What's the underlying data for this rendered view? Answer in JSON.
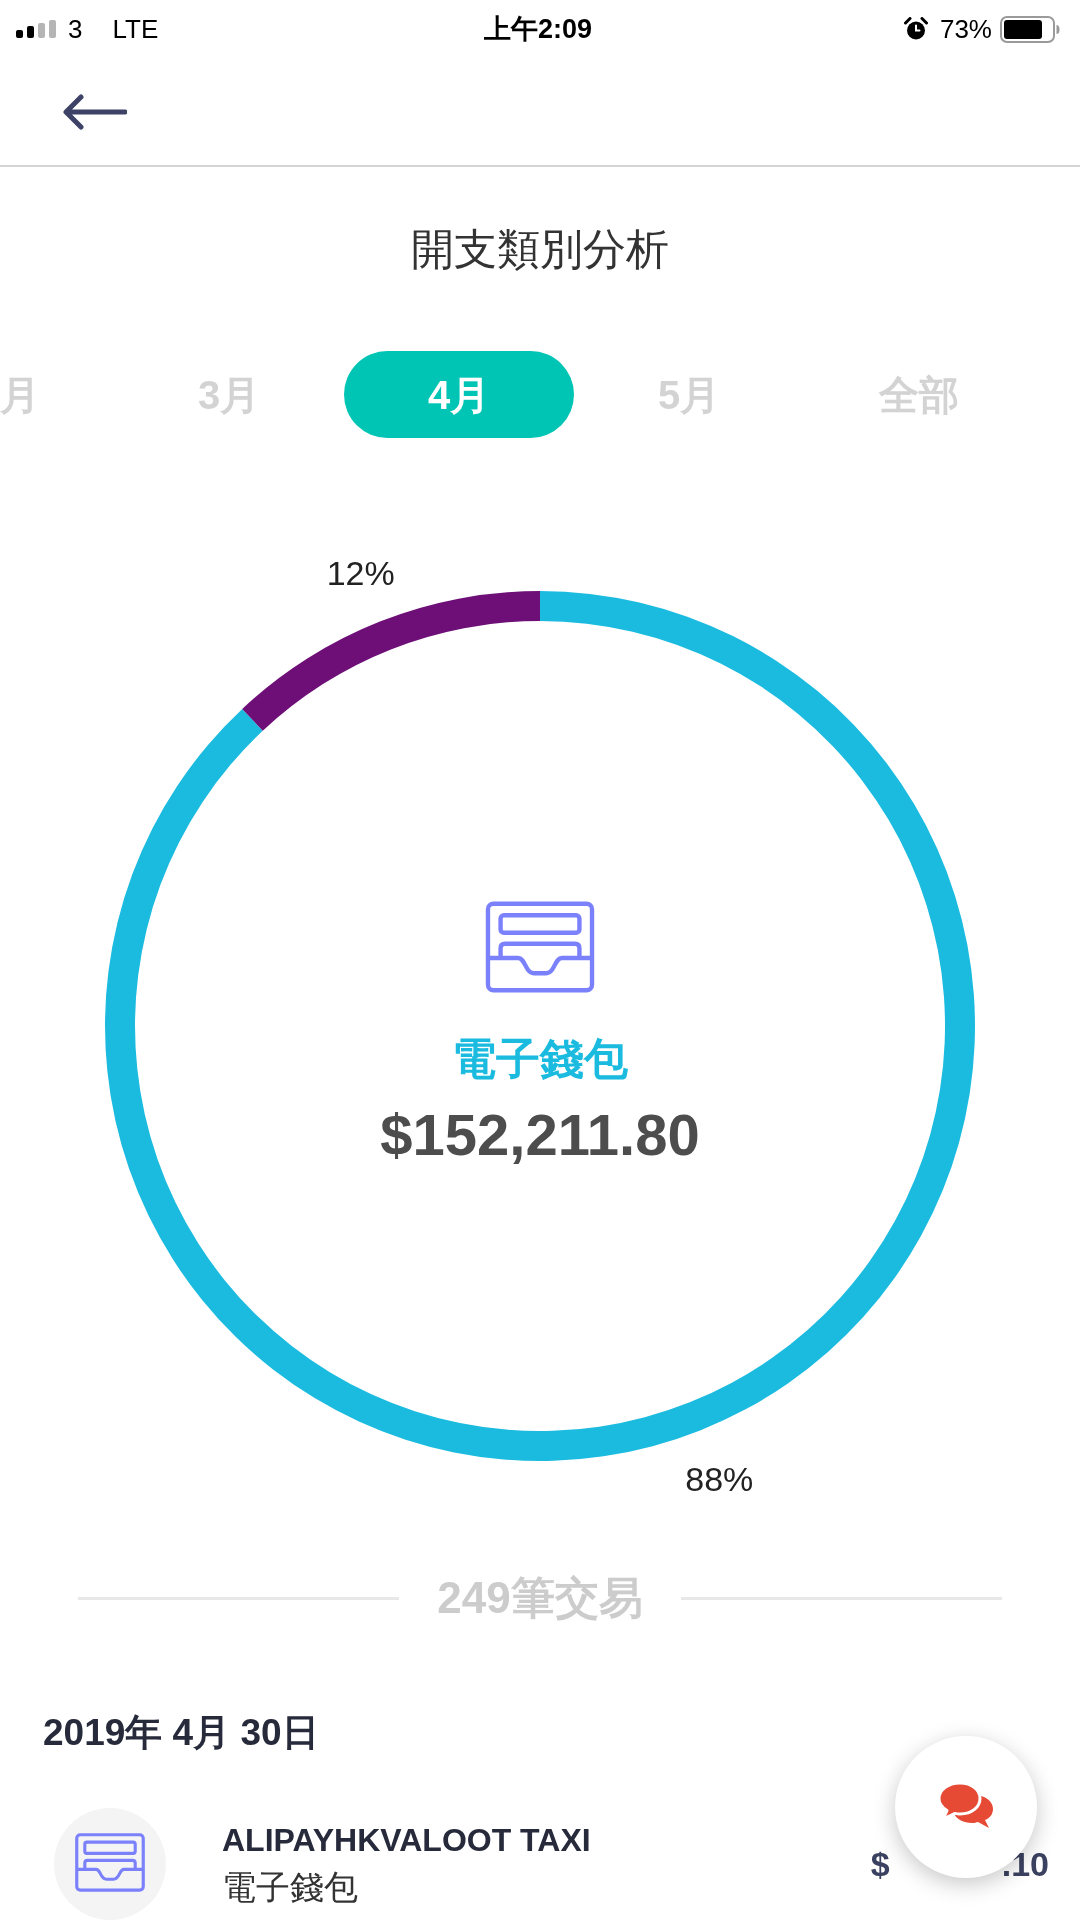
{
  "status_bar": {
    "carrier": "3",
    "network": "LTE",
    "time": "上午2:09",
    "battery": "73%"
  },
  "title": "開支類別分析",
  "month_tabs": [
    {
      "label": "月",
      "selected": false
    },
    {
      "label": "3月",
      "selected": false
    },
    {
      "label": "4月",
      "selected": true
    },
    {
      "label": "5月",
      "selected": false
    },
    {
      "label": "全部",
      "selected": false
    }
  ],
  "breakdown": {
    "category": "電子錢包",
    "amount": "$152,211.80",
    "chart_data": {
      "type": "donut",
      "values": [
        88,
        12
      ],
      "value_labels": [
        "88%",
        "12%"
      ],
      "colors": [
        "#1bbbe0",
        "#6e0f78"
      ]
    }
  },
  "transaction_count": "249筆交易",
  "transaction_groups": [
    {
      "date": "2019年 4月 30日",
      "items": [
        {
          "merchant": "ALIPAYHKVALOOT TAXI",
          "category": "電子錢包",
          "amount_parts": [
            "$",
            ".10"
          ]
        }
      ]
    }
  ]
}
